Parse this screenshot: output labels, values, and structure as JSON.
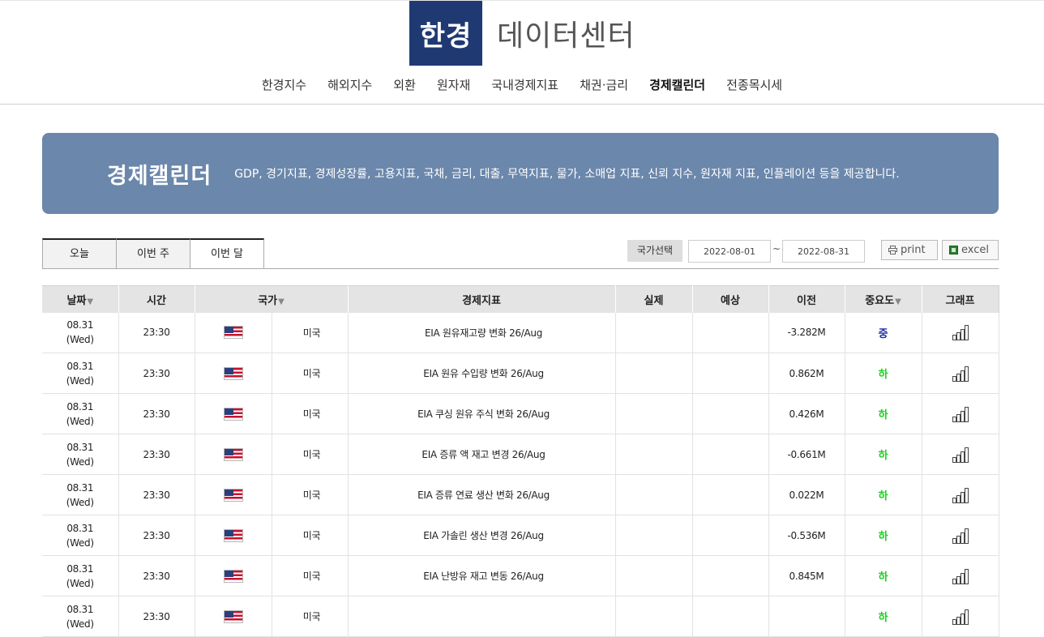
{
  "header": {
    "logo_mark": "한경",
    "logo_text": "데이터센터",
    "nav": [
      {
        "label": "한경지수",
        "active": false
      },
      {
        "label": "해외지수",
        "active": false
      },
      {
        "label": "외환",
        "active": false
      },
      {
        "label": "원자재",
        "active": false
      },
      {
        "label": "국내경제지표",
        "active": false
      },
      {
        "label": "채권·금리",
        "active": false
      },
      {
        "label": "경제캘린더",
        "active": true
      },
      {
        "label": "전종목시세",
        "active": false
      }
    ]
  },
  "banner": {
    "title": "경제캘린더",
    "description": "GDP, 경기지표, 경제성장률, 고용지표, 국채, 금리, 대출, 무역지표, 물가, 소매업 지표, 신뢰 지수, 원자재 지표, 인플레이션 등을 제공합니다."
  },
  "tabs": [
    {
      "label": "오늘",
      "active": false
    },
    {
      "label": "이번 주",
      "active": false
    },
    {
      "label": "이번 달",
      "active": true
    }
  ],
  "filters": {
    "country_label": "국가선택",
    "date_from": "2022-08-01",
    "date_sep": "~",
    "date_to": "2022-08-31",
    "print_label": "print",
    "excel_label": "excel"
  },
  "table": {
    "headers": {
      "date": "날짜",
      "time": "시간",
      "country": "국가",
      "indicator": "경제지표",
      "actual": "실제",
      "forecast": "예상",
      "previous": "이전",
      "importance": "중요도",
      "graph": "그래프"
    },
    "sort_caret": "▼",
    "rows": [
      {
        "date": "08.31",
        "day": "(Wed)",
        "time": "23:30",
        "country": "미국",
        "indicator": "EIA 원유재고량 변화 26/Aug",
        "actual": "",
        "forecast": "",
        "previous": "-3.282M",
        "importance": "중",
        "level": "mid"
      },
      {
        "date": "08.31",
        "day": "(Wed)",
        "time": "23:30",
        "country": "미국",
        "indicator": "EIA 원유 수입량 변화 26/Aug",
        "actual": "",
        "forecast": "",
        "previous": "0.862M",
        "importance": "하",
        "level": "low"
      },
      {
        "date": "08.31",
        "day": "(Wed)",
        "time": "23:30",
        "country": "미국",
        "indicator": "EIA 쿠싱 원유 주식 변화 26/Aug",
        "actual": "",
        "forecast": "",
        "previous": "0.426M",
        "importance": "하",
        "level": "low"
      },
      {
        "date": "08.31",
        "day": "(Wed)",
        "time": "23:30",
        "country": "미국",
        "indicator": "EIA 증류 액 재고 변경 26/Aug",
        "actual": "",
        "forecast": "",
        "previous": "-0.661M",
        "importance": "하",
        "level": "low"
      },
      {
        "date": "08.31",
        "day": "(Wed)",
        "time": "23:30",
        "country": "미국",
        "indicator": "EIA 증류 연료 생산 변화 26/Aug",
        "actual": "",
        "forecast": "",
        "previous": "0.022M",
        "importance": "하",
        "level": "low"
      },
      {
        "date": "08.31",
        "day": "(Wed)",
        "time": "23:30",
        "country": "미국",
        "indicator": "EIA 가솔린 생산 변경 26/Aug",
        "actual": "",
        "forecast": "",
        "previous": "-0.536M",
        "importance": "하",
        "level": "low"
      },
      {
        "date": "08.31",
        "day": "(Wed)",
        "time": "23:30",
        "country": "미국",
        "indicator": "EIA 난방유 재고 변동 26/Aug",
        "actual": "",
        "forecast": "",
        "previous": "0.845M",
        "importance": "하",
        "level": "low"
      },
      {
        "date": "08.31",
        "day": "(Wed)",
        "time": "23:30",
        "country": "미국",
        "indicator": "",
        "actual": "",
        "forecast": "",
        "previous": "",
        "importance": "하",
        "level": "low"
      }
    ]
  }
}
